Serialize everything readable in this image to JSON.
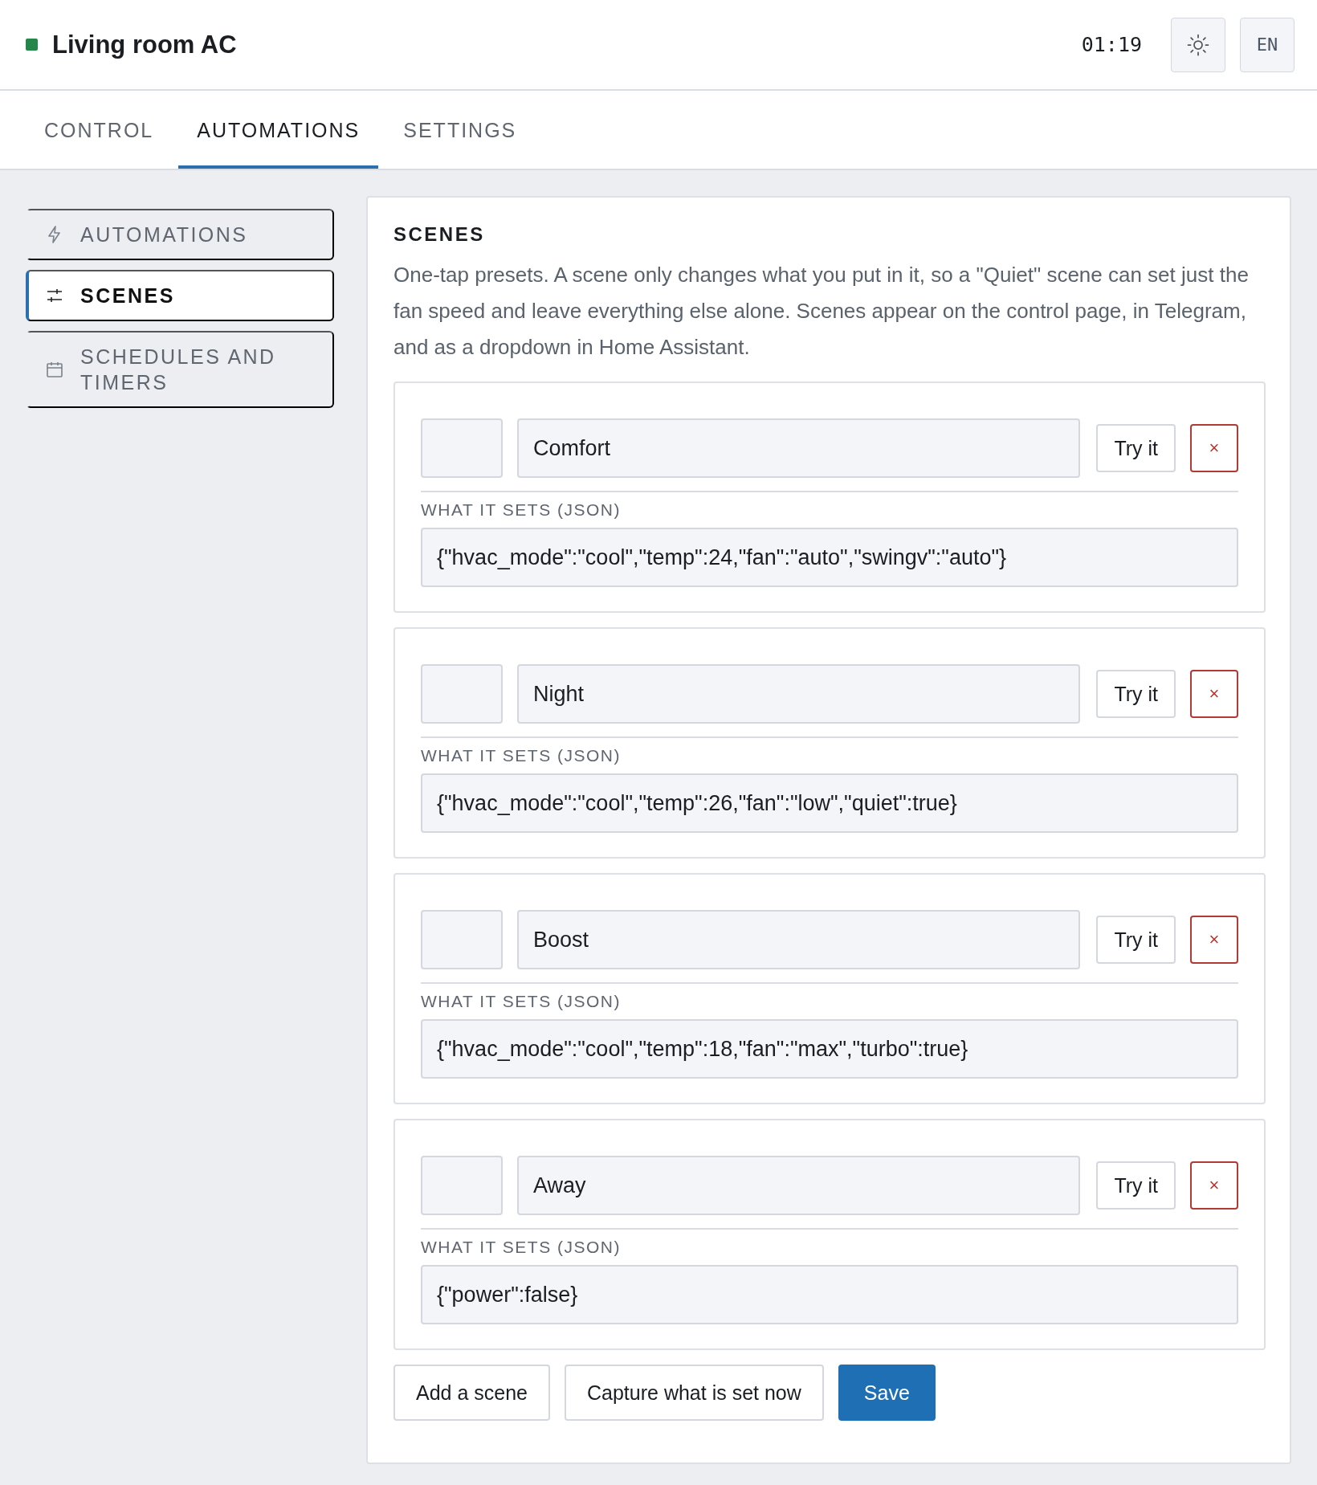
{
  "header": {
    "title": "Living room AC",
    "online": true,
    "clock": "01:19",
    "language": "EN"
  },
  "tabs": [
    {
      "label": "CONTROL",
      "selected": false
    },
    {
      "label": "AUTOMATIONS",
      "selected": true
    },
    {
      "label": "SETTINGS",
      "selected": false
    }
  ],
  "sidebar": {
    "items": [
      {
        "kind": "bolt",
        "label": "AUTOMATIONS",
        "selected": false
      },
      {
        "kind": "sliders",
        "label": "SCENES",
        "selected": true
      },
      {
        "kind": "calendar",
        "label": "SCHEDULES AND TIMERS",
        "selected": false
      }
    ]
  },
  "section": {
    "title": "SCENES",
    "description": "One-tap presets. A scene only changes what you put in it, so a \"Quiet\" scene can set just the fan speed and leave everything else alone. Scenes appear on the control page, in Telegram, and as a dropdown in Home Assistant.",
    "scenes": [
      {
        "name": "Comfort",
        "try_label": "Try it",
        "delete_label": "×",
        "json_label": "WHAT IT SETS (JSON)",
        "json": "{\"hvac_mode\":\"cool\",\"temp\":24,\"fan\":\"auto\",\"swingv\":\"auto\"}"
      },
      {
        "name": "Night",
        "try_label": "Try it",
        "delete_label": "×",
        "json_label": "WHAT IT SETS (JSON)",
        "json": "{\"hvac_mode\":\"cool\",\"temp\":26,\"fan\":\"low\",\"quiet\":true}"
      },
      {
        "name": "Boost",
        "try_label": "Try it",
        "delete_label": "×",
        "json_label": "WHAT IT SETS (JSON)",
        "json": "{\"hvac_mode\":\"cool\",\"temp\":18,\"fan\":\"max\",\"turbo\":true}"
      },
      {
        "name": "Away",
        "try_label": "Try it",
        "delete_label": "×",
        "json_label": "WHAT IT SETS (JSON)",
        "json": "{\"power\":false}"
      }
    ],
    "buttons": [
      {
        "label": "Add a scene",
        "kind": "secondary"
      },
      {
        "label": "Capture what is set now",
        "kind": "secondary"
      },
      {
        "label": "Save",
        "kind": "primary"
      }
    ]
  }
}
